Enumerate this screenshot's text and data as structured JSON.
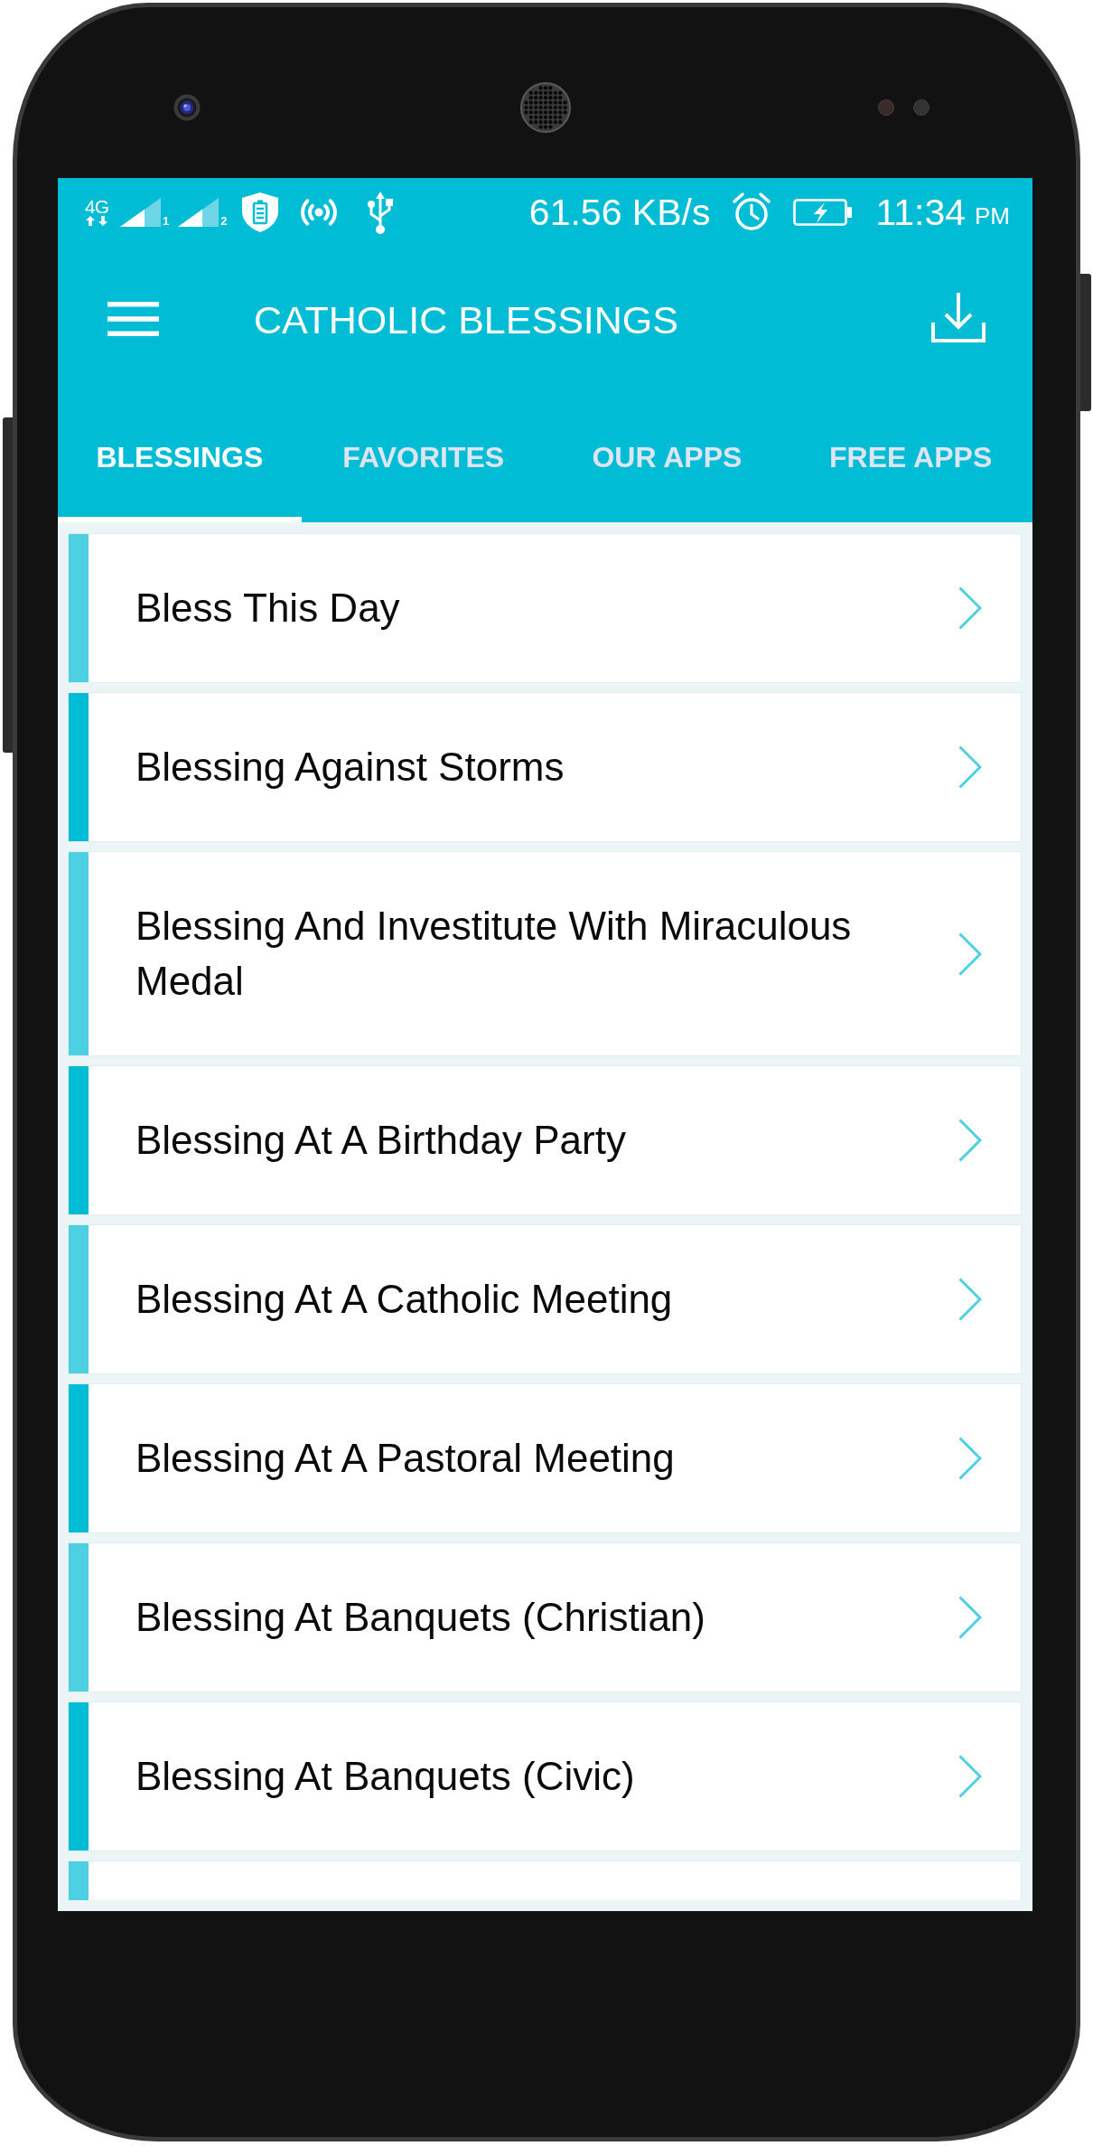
{
  "status_bar": {
    "network_type": "4G",
    "sim_slots": [
      "1",
      "2"
    ],
    "speed": "61.56 KB/s",
    "time": "11:34",
    "period": "PM"
  },
  "app_bar": {
    "title": "CATHOLIC BLESSINGS"
  },
  "tabs": [
    {
      "label": "BLESSINGS",
      "selected": true
    },
    {
      "label": "FAVORITES",
      "selected": false
    },
    {
      "label": "OUR APPS",
      "selected": false
    },
    {
      "label": "FREE APPS",
      "selected": false
    }
  ],
  "items": [
    {
      "label": "Bless This Day",
      "color": "#4dd0e1"
    },
    {
      "label": "Blessing Against Storms",
      "color": "#00bcd4"
    },
    {
      "label": "Blessing And Investitute With Miraculous Medal",
      "color": "#4dd0e1"
    },
    {
      "label": "Blessing At A Birthday Party",
      "color": "#00bcd4"
    },
    {
      "label": "Blessing At A Catholic Meeting",
      "color": "#4dd0e1"
    },
    {
      "label": "Blessing At A Pastoral Meeting",
      "color": "#00bcd4"
    },
    {
      "label": "Blessing At Banquets (Christian)",
      "color": "#4dd0e1"
    },
    {
      "label": "Blessing At Banquets (Civic)",
      "color": "#00bcd4"
    },
    {
      "color": "#4dd0e1"
    }
  ]
}
